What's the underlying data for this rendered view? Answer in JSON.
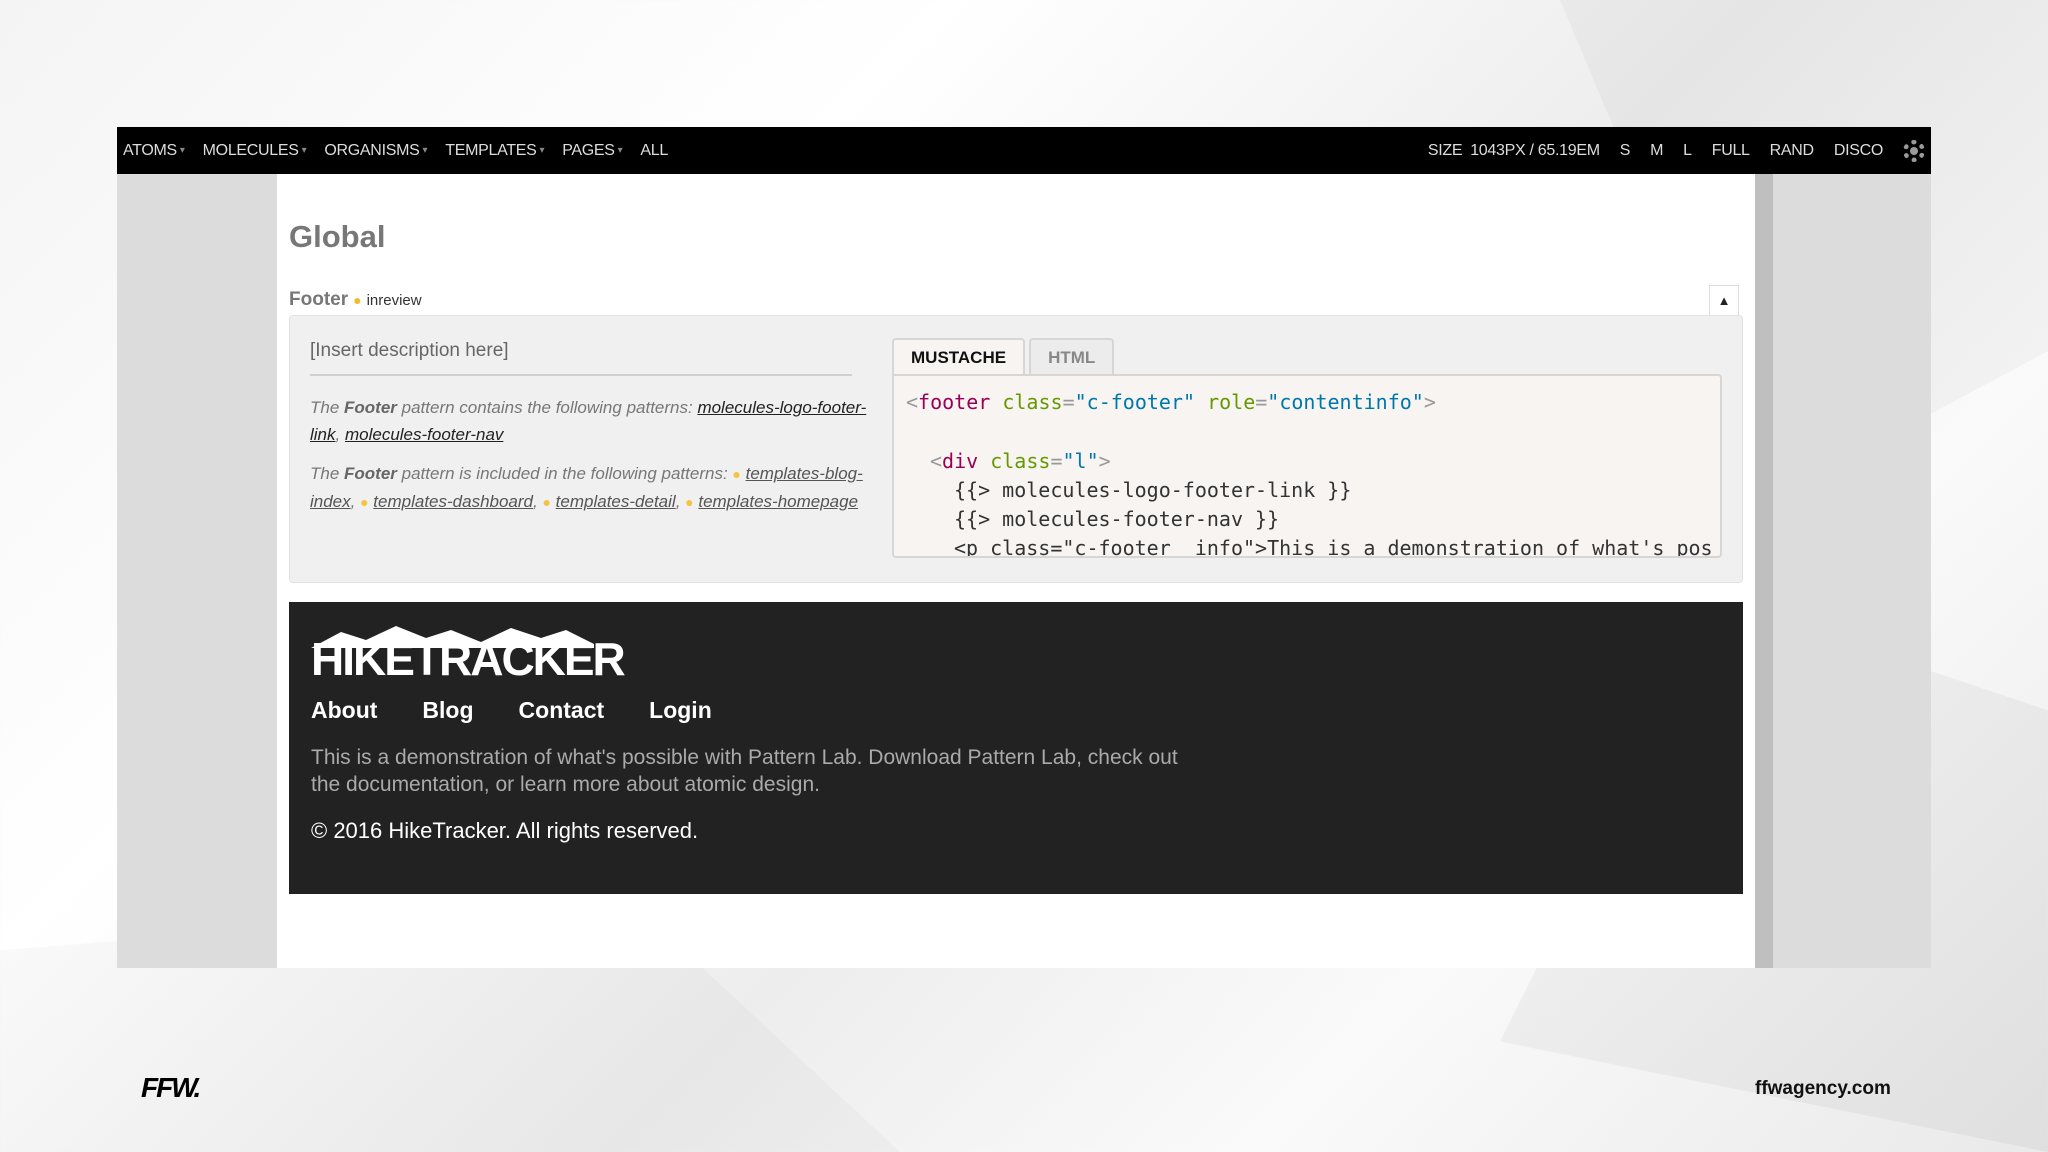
{
  "toolbar": {
    "nav": [
      {
        "label": "ATOMS",
        "caret": "▾"
      },
      {
        "label": "MOLECULES",
        "caret": "▾"
      },
      {
        "label": "ORGANISMS",
        "caret": "▾"
      },
      {
        "label": "TEMPLATES",
        "caret": "▾"
      },
      {
        "label": "PAGES",
        "caret": "▾"
      },
      {
        "label": "ALL",
        "caret": ""
      }
    ],
    "size_label": "SIZE",
    "size_value": "1043PX / 65.19EM",
    "sizes": [
      "S",
      "M",
      "L",
      "FULL",
      "RAND",
      "DISCO"
    ],
    "settings_icon": "gear-icon"
  },
  "page": {
    "title": "Global",
    "pattern_name": "Footer",
    "state": "inreview",
    "state_color": "#f5b931",
    "collapse_glyph": "▲",
    "description": "[Insert description here]",
    "contains_prefix": "The ",
    "contains_name": "Footer",
    "contains_suffix": " pattern contains the following patterns: ",
    "contains_links": [
      "molecules-logo-footer-link",
      "molecules-footer-nav"
    ],
    "included_prefix": "The ",
    "included_name": "Footer",
    "included_suffix": " pattern is included in the following patterns: ",
    "included_links": [
      "templates-blog-index",
      "templates-dashboard",
      "templates-detail",
      "templates-homepage"
    ],
    "tabs": [
      {
        "label": "MUSTACHE",
        "active": true
      },
      {
        "label": "HTML",
        "active": false
      }
    ],
    "code": {
      "l1_tag": "footer",
      "l1_attr1": "class",
      "l1_val1": "\"c-footer\"",
      "l1_attr2": "role",
      "l1_val2": "\"contentinfo\"",
      "l2_tag": "div",
      "l2_attr": "class",
      "l2_val": "\"l\"",
      "l3": "{{> molecules-logo-footer-link }}",
      "l4": "{{> molecules-footer-nav }}",
      "l5": "<p class=\"c-footer__info\">This is a demonstration of what's pos"
    }
  },
  "site_footer": {
    "logo": "HIKETRACKER",
    "nav": [
      "About",
      "Blog",
      "Contact",
      "Login"
    ],
    "info": "This is a demonstration of what's possible with Pattern Lab. Download Pattern Lab, check out the documentation, or learn more about atomic design.",
    "copyright": "© 2016 HikeTracker. All rights reserved."
  },
  "branding": {
    "logo": "FFW.",
    "url": "ffwagency.com"
  }
}
